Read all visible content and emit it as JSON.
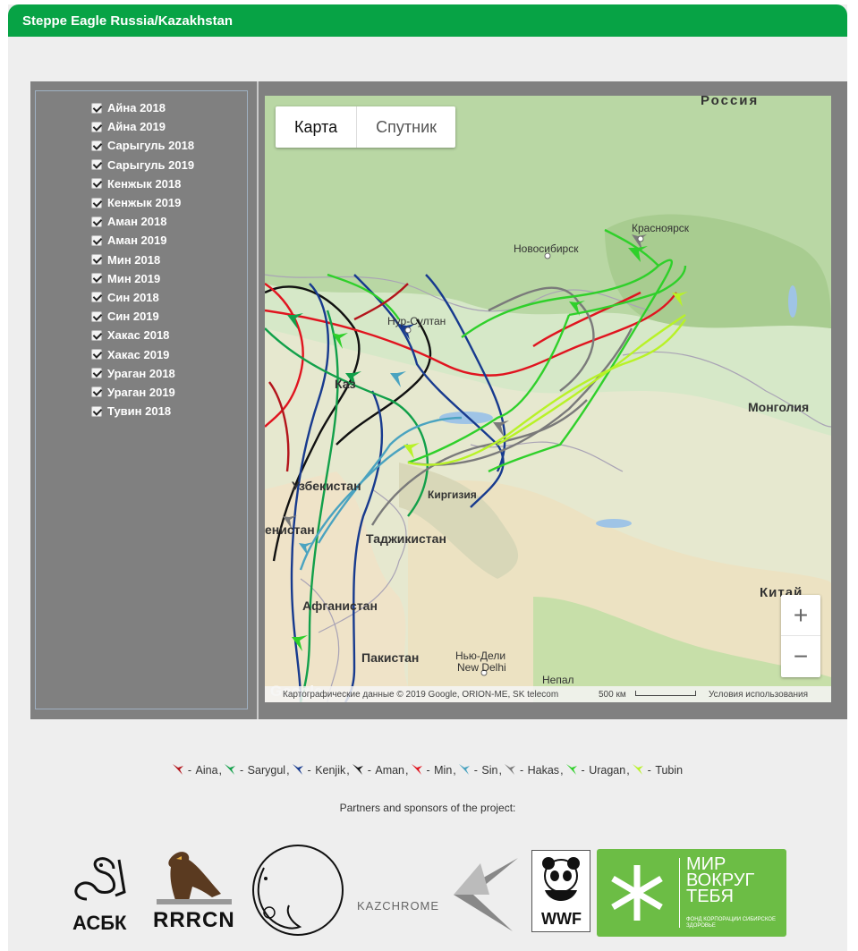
{
  "header": {
    "title": "Steppe Eagle Russia/Kazakhstan"
  },
  "layers": [
    {
      "label": "Айна 2018",
      "checked": true
    },
    {
      "label": "Айна 2019",
      "checked": true
    },
    {
      "label": "Сарыгуль 2018",
      "checked": true
    },
    {
      "label": "Сарыгуль 2019",
      "checked": true
    },
    {
      "label": "Кенжык 2018",
      "checked": true
    },
    {
      "label": "Кенжык 2019",
      "checked": true
    },
    {
      "label": "Аман 2018",
      "checked": true
    },
    {
      "label": "Аман 2019",
      "checked": true
    },
    {
      "label": "Мин 2018",
      "checked": true
    },
    {
      "label": "Мин 2019",
      "checked": true
    },
    {
      "label": "Син 2018",
      "checked": true
    },
    {
      "label": "Син 2019",
      "checked": true
    },
    {
      "label": "Хакас 2018",
      "checked": true
    },
    {
      "label": "Хакас 2019",
      "checked": true
    },
    {
      "label": "Ураган 2018",
      "checked": true
    },
    {
      "label": "Ураган 2019",
      "checked": true
    },
    {
      "label": "Тувин 2018",
      "checked": true
    }
  ],
  "map": {
    "map_button": "Карта",
    "satellite_button": "Спутник",
    "zoom_in": "+",
    "zoom_out": "−",
    "attribution": "Картографические данные © 2019 Google, ORION-ME, SK telecom",
    "scale": "500 км",
    "terms": "Условия использования",
    "google": "Google",
    "labels": {
      "russia": "Россия",
      "krasnoyarsk": "Красноярск",
      "novosibirsk": "Новосибирск",
      "nursultan": "Нур-Султан",
      "mongolia": "Монголия",
      "uzbekistan": "Узбекистан",
      "kyrgyzstan": "Киргизия",
      "tajikistan": "Таджикистан",
      "turkmenistan": "енистан",
      "afghanistan": "Афганистан",
      "pakistan": "Пакистан",
      "newdelhi_ru": "Нью-Дели",
      "newdelhi_en": "New Delhi",
      "nepal": "Непал",
      "china": "Китай",
      "kaz_partial": "Каз"
    }
  },
  "legend": [
    {
      "name": "Aina",
      "color": "#b3141b"
    },
    {
      "name": "Sarygul",
      "color": "#12a04a"
    },
    {
      "name": "Kenjik",
      "color": "#173a8e"
    },
    {
      "name": "Aman",
      "color": "#111111"
    },
    {
      "name": "Min",
      "color": "#e0141f"
    },
    {
      "name": "Sin",
      "color": "#4aa3c0"
    },
    {
      "name": "Hakas",
      "color": "#7a7a7a"
    },
    {
      "name": "Uragan",
      "color": "#2fd02a"
    },
    {
      "name": "Tubin",
      "color": "#b8f227"
    }
  ],
  "partners_title": "Partners and sponsors of the project:",
  "partners": {
    "asbk": "АСБК",
    "rrrcn": "RRRCN",
    "kazchrome": "KAZCHROME",
    "wwf": "WWF",
    "mir_title": "МИР ВОКРУГ ТЕБЯ",
    "mir_sub": "ФОНД КОРПОРАЦИИ СИБИРСКОЕ ЗДОРОВЬЕ"
  },
  "colors": {
    "header": "#07a345",
    "panel": "#808080",
    "mir": "#6cbd45"
  }
}
